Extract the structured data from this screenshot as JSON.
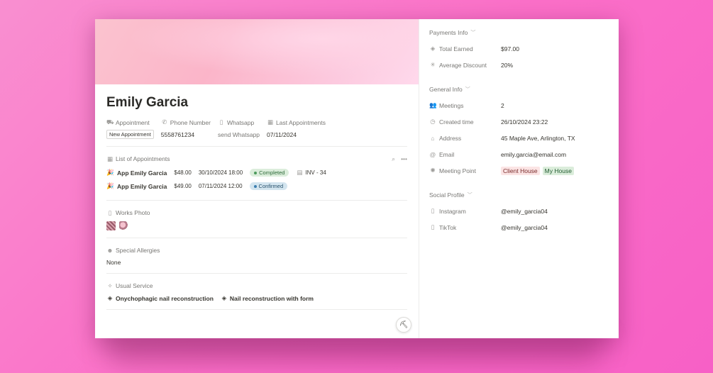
{
  "profile": {
    "name": "Emily Garcia",
    "properties": [
      {
        "icon": "tag-icon",
        "glyph": "⛟",
        "label": "Appointment",
        "value": "New Appointment",
        "style": "outline"
      },
      {
        "icon": "phone-icon",
        "glyph": "✆",
        "label": "Phone Number",
        "value": "5558761234",
        "style": "plain"
      },
      {
        "icon": "whatsapp-icon",
        "glyph": "▯",
        "label": "Whatsapp",
        "value": "send Whatsapp",
        "style": "muted"
      },
      {
        "icon": "calendar-icon",
        "glyph": "▦",
        "label": "Last Appointments",
        "value": "07/11/2024",
        "style": "plain"
      }
    ]
  },
  "appointments": {
    "label": "List of Appointments",
    "items": [
      {
        "name": "App Emily Garcia",
        "price": "$48.00",
        "datetime": "30/10/2024 18:00",
        "status": "Completed",
        "status_color": "green",
        "invoice": "INV - 34"
      },
      {
        "name": "App Emily Garcia",
        "price": "$49.00",
        "datetime": "07/11/2024 12:00",
        "status": "Confirmed",
        "status_color": "blue",
        "invoice": ""
      }
    ]
  },
  "works_photo": {
    "label": "Works Photo"
  },
  "allergies": {
    "label": "Special Allergies",
    "value": "None"
  },
  "usual_service": {
    "label": "Usual Service",
    "items": [
      "Onychophagic nail reconstruction",
      "Nail reconstruction with form"
    ]
  },
  "payments": {
    "label": "Payments Info",
    "rows": [
      {
        "icon": "diamond-icon",
        "glyph": "◈",
        "label": "Total Earned",
        "value": "$97.00"
      },
      {
        "icon": "asterisk-icon",
        "glyph": "✳",
        "label": "Average Discount",
        "value": "20%"
      }
    ]
  },
  "general": {
    "label": "General Info",
    "meetings": {
      "label": "Meetings",
      "value": "2"
    },
    "created": {
      "label": "Created time",
      "value": "26/10/2024 23:22"
    },
    "address": {
      "label": "Address",
      "value": "45 Maple Ave, Arlington, TX"
    },
    "email": {
      "label": "Email",
      "value": "emily.garcia@email.com"
    },
    "meeting_point": {
      "label": "Meeting Point",
      "tags": [
        "Client House",
        "My House"
      ]
    }
  },
  "social": {
    "label": "Social Profile",
    "instagram": {
      "label": "Instagram",
      "value": "@emily_garcia04"
    },
    "tiktok": {
      "label": "TikTok",
      "value": "@emily_garcia04"
    }
  },
  "colors": {
    "accent_bg": "#fb6fc8",
    "completed": "#dbeddb",
    "confirmed": "#d3e5ef"
  }
}
